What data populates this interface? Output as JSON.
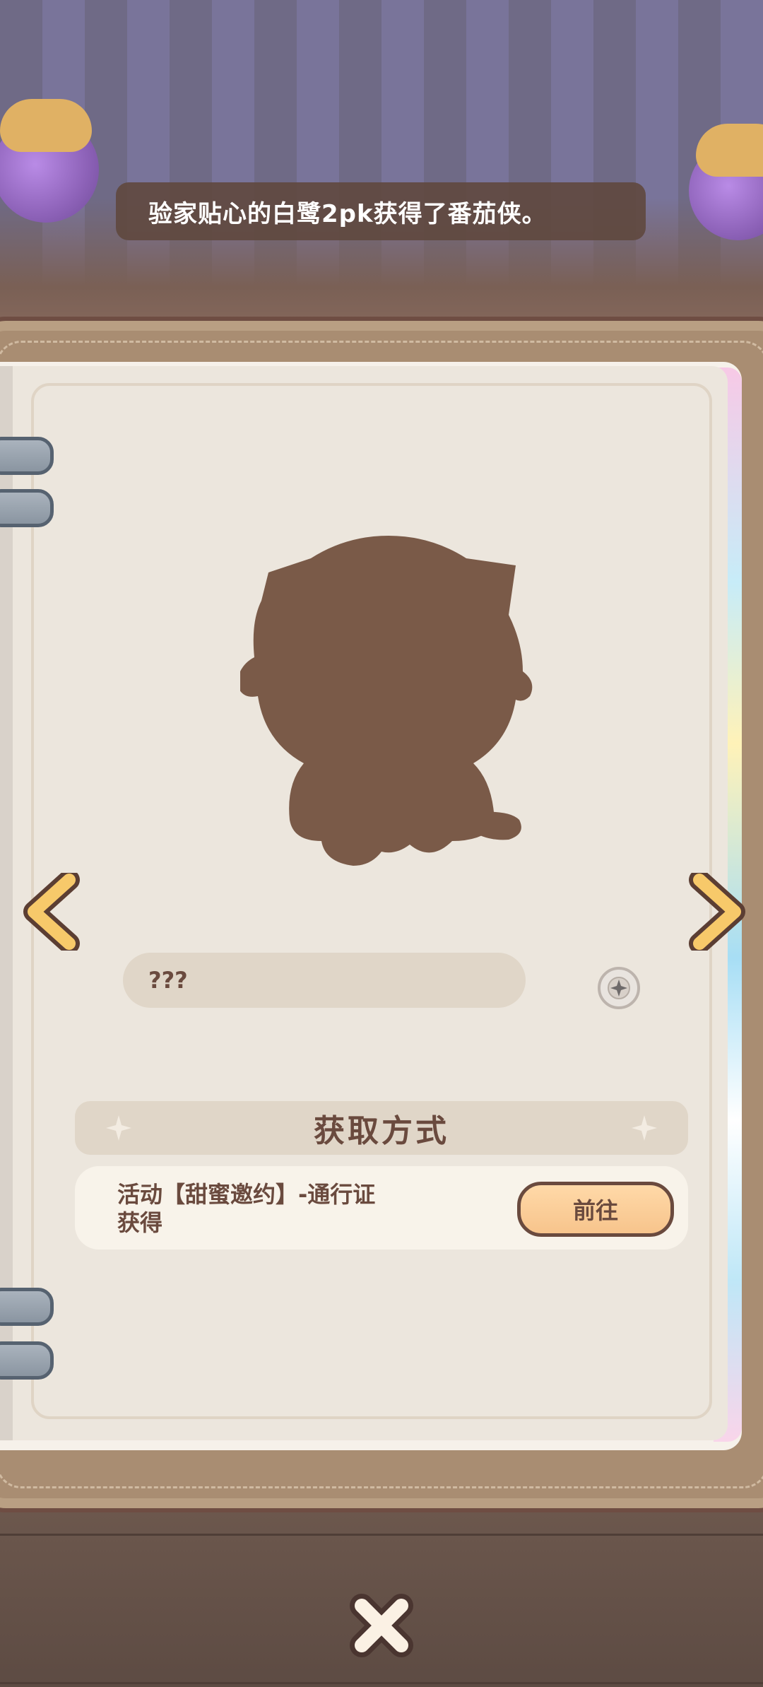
{
  "toast": {
    "message": "验家贴心的白鹭2pk获得了番茄侠。"
  },
  "character": {
    "name": "???"
  },
  "acquisition": {
    "header": "获取方式",
    "source_line1": "活动【甜蜜邀约】-通行证",
    "source_line2": "获得",
    "goto_label": "前往"
  },
  "icons": {
    "prev": "chevron-left-icon",
    "next": "chevron-right-icon",
    "close": "close-x-icon",
    "compass": "compass-icon",
    "sparkle": "sparkle-icon"
  },
  "colors": {
    "text_brown": "#6a4a3e",
    "arrow_orange": "#f7c96a",
    "button_peach": "#f7c48c",
    "silhouette": "#7a5a48"
  }
}
